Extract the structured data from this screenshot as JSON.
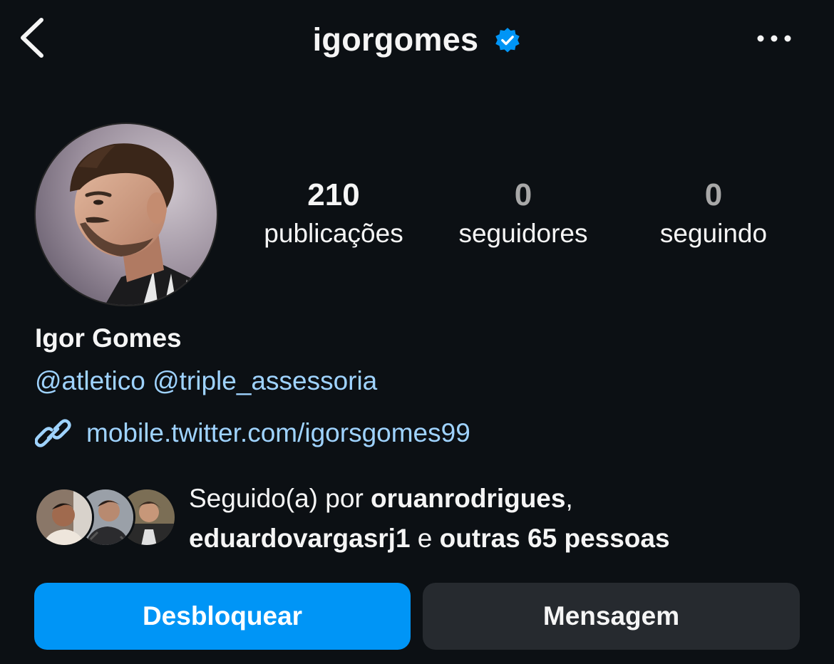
{
  "header": {
    "username": "igorgomes",
    "back_icon": "chevron-left-icon",
    "verified_icon": "verified-badge-icon",
    "more_icon": "more-horizontal-icon"
  },
  "stats": {
    "posts": {
      "value": "210",
      "label": "publicações"
    },
    "followers": {
      "value": "0",
      "label": "seguidores"
    },
    "following": {
      "value": "0",
      "label": "seguindo"
    }
  },
  "bio": {
    "full_name": "Igor Gomes",
    "mention_1": "@atletico",
    "mention_2": "@triple_assessoria",
    "link_icon": "link-icon",
    "link": "mobile.twitter.com/igorsgomes99"
  },
  "followed_by": {
    "prefix": "Seguido(a) por ",
    "user_1": "oruanrodrigues",
    "sep": ",",
    "user_2": "eduardovargasrj1",
    "conj": " e ",
    "others": "outras 65 pessoas"
  },
  "actions": {
    "unblock_label": "Desbloquear",
    "message_label": "Mensagem"
  },
  "colors": {
    "background": "#0c1014",
    "accent_blue": "#0095f6",
    "link_blue": "#9fd3ff",
    "secondary_button": "#262a2f",
    "verified_blue": "#0095f6"
  }
}
